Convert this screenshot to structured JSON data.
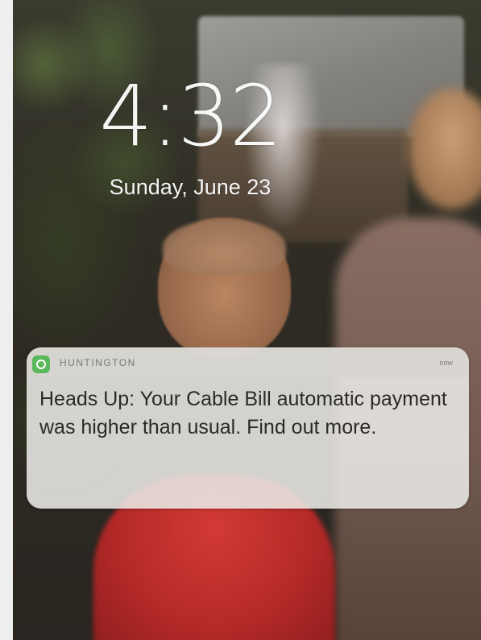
{
  "lock_screen": {
    "time": "4:32",
    "date": "Sunday, June 23"
  },
  "notification": {
    "app_name": "HUNTINGTON",
    "app_icon": "huntington-app-icon",
    "timestamp": "now",
    "message": "Heads Up: Your Cable Bill automatic payment was higher than usual. Find out more."
  },
  "colors": {
    "app_icon_bg": "#5cb85c",
    "notification_text": "#2a2a2a"
  }
}
